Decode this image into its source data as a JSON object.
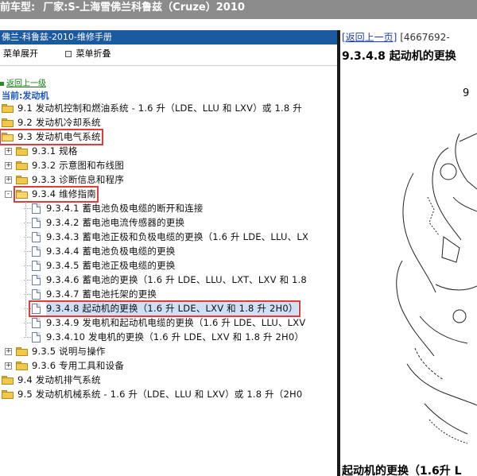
{
  "topbar": {
    "prefix": "前车型:",
    "text": "厂家:S-上海雪佛兰科鲁兹（Cruze）2010"
  },
  "left": {
    "manual_title": "佛兰-科鲁兹-2010-维修手册",
    "toolbar": {
      "expand_label": "菜单展开",
      "collapse_label": "菜单折叠"
    },
    "back_link": "返回上一级",
    "current": "当前:发动机"
  },
  "tree": [
    {
      "label": "9.1 发动机控制和燃油系统 - 1.6 升（LDE、LLU 和 LXV）或 1.8 升"
    },
    {
      "label": "9.2 发动机冷却系统"
    },
    {
      "label": "9.3 发动机电气系统"
    },
    {
      "label": "9.3.1 规格"
    },
    {
      "label": "9.3.2 示意图和布线图"
    },
    {
      "label": "9.3.3 诊断信息和程序"
    },
    {
      "label": "9.3.4 维修指南"
    },
    {
      "label": "9.3.4.1 蓄电池负极电缆的断开和连接"
    },
    {
      "label": "9.3.4.2 蓄电池电流传感器的更换"
    },
    {
      "label": "9.3.4.3 蓄电池正极和负极电缆的更换（1.6 升 LDE、LLU、LX"
    },
    {
      "label": "9.3.4.4 蓄电池负极电缆的更换"
    },
    {
      "label": "9.3.4.5 蓄电池正极电缆的更换"
    },
    {
      "label": "9.3.4.6 蓄电池的更换（1.6 升 LDE、LLU、LXT、LXV 和 1.8"
    },
    {
      "label": "9.3.4.7 蓄电池托架的更换"
    },
    {
      "label": "9.3.4.8 起动机的更换（1.6 升 LDE、LXV 和 1.8 升 2H0）"
    },
    {
      "label": "9.3.4.9 发电机和起动机电缆的更换（1.6 升 LDE、LLU、LXV"
    },
    {
      "label": "9.3.4.10 发电机的更换（1.6 升 LDE、LXV 和 1.8 升 2H0）"
    },
    {
      "label": "9.3.5 说明与操作"
    },
    {
      "label": "9.3.6 专用工具和设备"
    },
    {
      "label": "9.4 发动机排气系统"
    },
    {
      "label": "9.5 发动机机械系统 - 1.6 升（LDE、LLU 和 LXV）或 1.8 升（2H0"
    }
  ],
  "right": {
    "back_link": "[返回上一页]",
    "doc_id": "[4667692-",
    "page_title": "9.3.4.8 起动机的更换",
    "callout": "9",
    "bottom_title": "起动机的更换（1.6升 L"
  }
}
